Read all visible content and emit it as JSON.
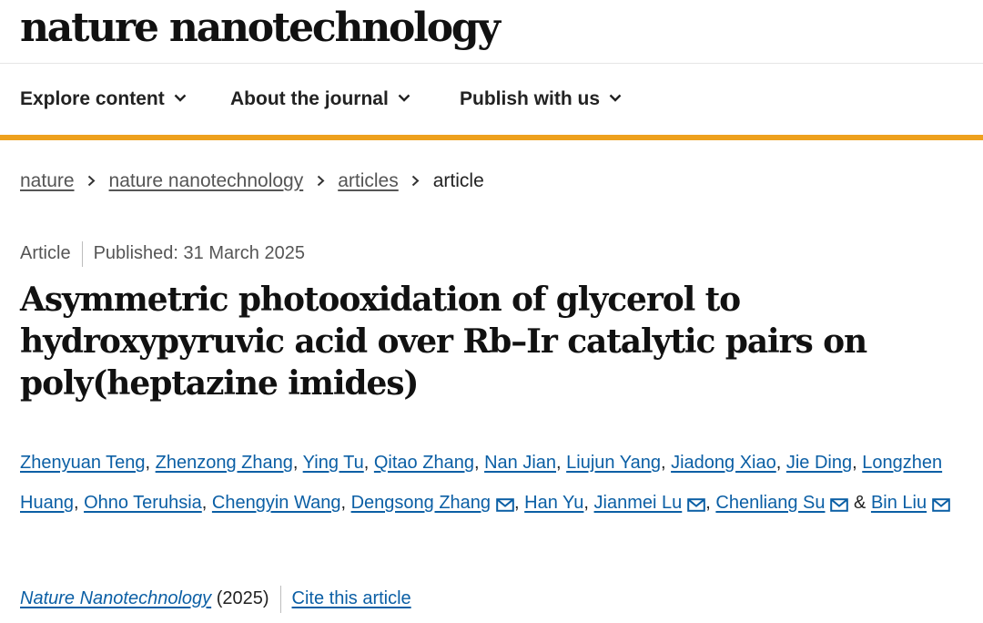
{
  "brand": "nature nanotechnology",
  "nav": {
    "items": [
      "Explore content",
      "About the journal",
      "Publish with us"
    ]
  },
  "breadcrumb": {
    "items": [
      "nature",
      "nature nanotechnology",
      "articles"
    ],
    "current": "article"
  },
  "article": {
    "type": "Article",
    "published": "Published: 31 March 2025",
    "title": "Asymmetric photooxidation of glycerol to hydroxypyruvic acid over Rb–Ir catalytic pairs on poly(heptazine imides)",
    "authors": [
      "Zhenyuan Teng",
      "Zhenzong Zhang",
      "Ying Tu",
      "Qitao Zhang",
      "Nan Jian",
      "Liujun Yang",
      "Jiadong Xiao",
      "Jie Ding",
      "Longzhen Huang",
      "Ohno Teruhsia",
      "Chengyin Wang",
      "Dengsong Zhang",
      "Han Yu",
      "Jianmei Lu",
      "Chenliang Su",
      "Bin Liu"
    ],
    "journal": "Nature Nanotechnology",
    "year": "(2025)",
    "cite": "Cite this article"
  },
  "colors": {
    "accent": "#eea11d",
    "link": "#0b5fa5"
  }
}
